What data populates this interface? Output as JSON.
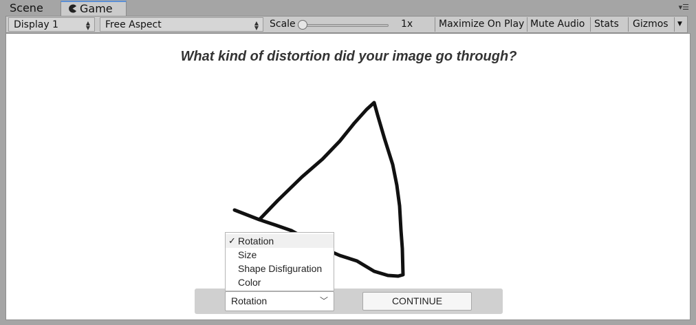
{
  "tabs": [
    {
      "label": "Scene",
      "icon": "scene-tab"
    },
    {
      "label": "Game",
      "icon": "pacman-icon",
      "active": true
    }
  ],
  "toolbar": {
    "display": "Display 1",
    "aspect": "Free Aspect",
    "scale_label": "Scale",
    "scale_value": "1x",
    "maximize": "Maximize On Play",
    "mute": "Mute Audio",
    "stats": "Stats",
    "gizmos": "Gizmos"
  },
  "game": {
    "question": "What kind of distortion did your image go through?",
    "dropdown": {
      "selected": "Rotation",
      "options": [
        "Rotation",
        "Size",
        "Shape Disfiguration",
        "Color"
      ]
    },
    "continue_label": "CONTINUE"
  },
  "colors": {
    "editor_bg": "#a5a5a5",
    "toolbar_bg": "#cbcbcb",
    "active_tab_accent": "#5b8fd6",
    "canvas_bg": "#ffffff",
    "stroke": "#111111"
  }
}
